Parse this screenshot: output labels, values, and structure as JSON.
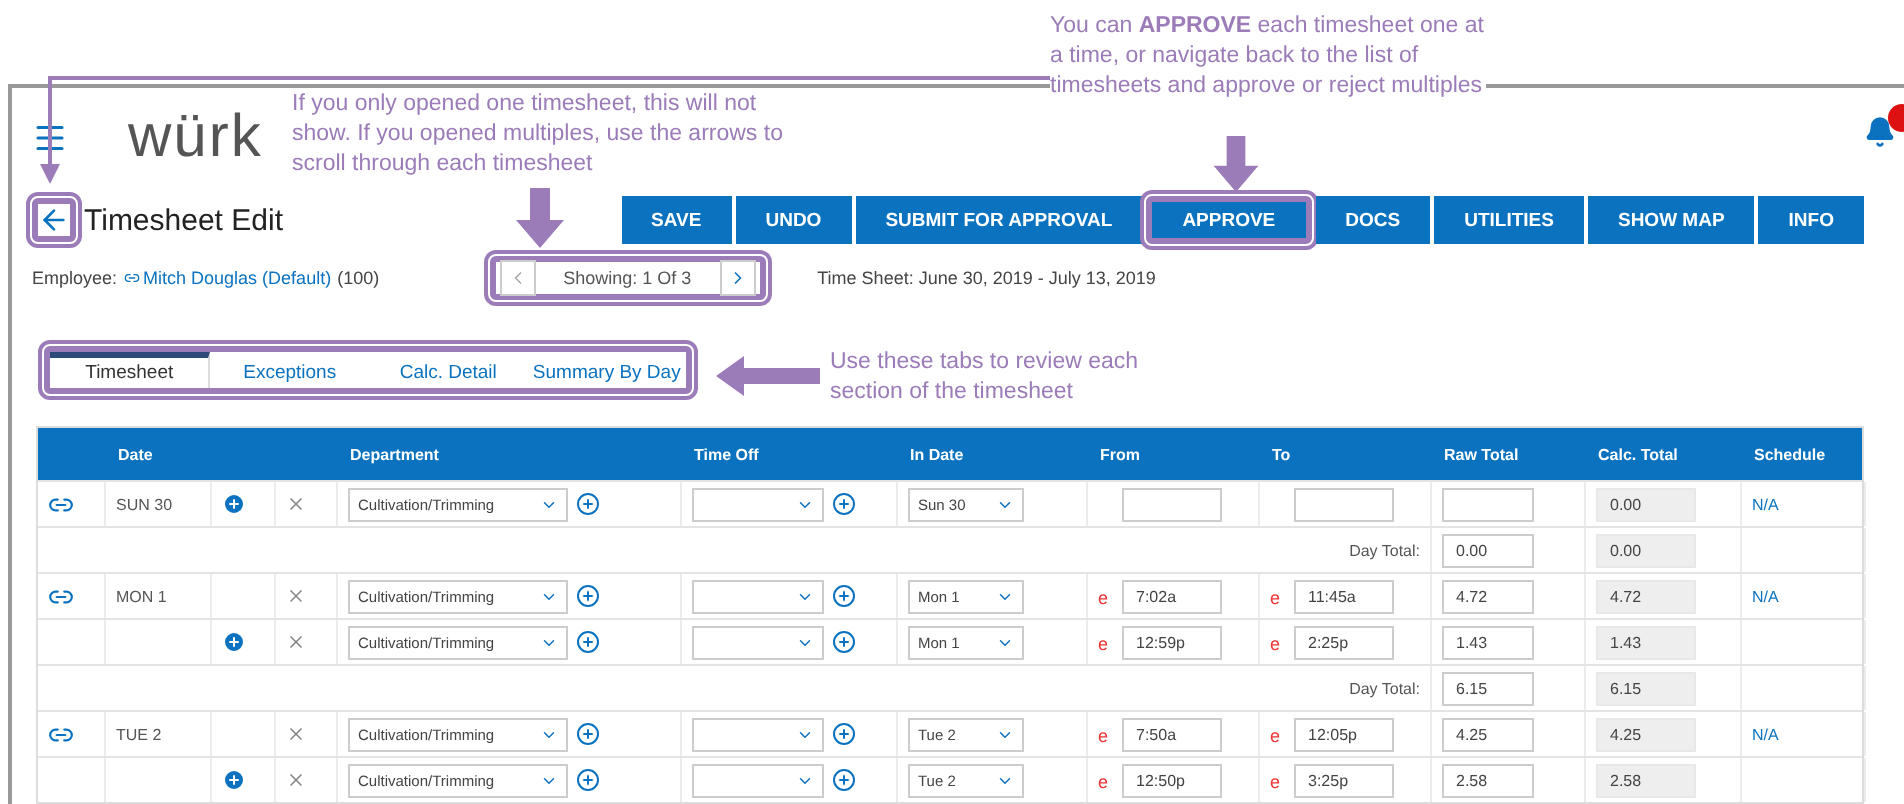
{
  "header": {
    "logo": "würk",
    "title": "Timesheet Edit",
    "back_highlighted": true
  },
  "toolbar": [
    {
      "label": "SAVE",
      "highlighted": false
    },
    {
      "label": "UNDO",
      "highlighted": false
    },
    {
      "label": "SUBMIT FOR APPROVAL",
      "highlighted": false
    },
    {
      "label": "APPROVE",
      "highlighted": true
    },
    {
      "label": "DOCS",
      "highlighted": false
    },
    {
      "label": "UTILITIES",
      "highlighted": false
    },
    {
      "label": "SHOW MAP",
      "highlighted": false
    },
    {
      "label": "INFO",
      "highlighted": false
    }
  ],
  "employee": {
    "label": "Employee:",
    "name": "Mitch Douglas (Default)",
    "number": "(100)"
  },
  "pager": {
    "text": "Showing: 1 Of 3",
    "highlighted": true
  },
  "period": "Time Sheet: June 30, 2019 - July 13, 2019",
  "tabs": {
    "highlighted": true,
    "items": [
      {
        "label": "Timesheet",
        "selected": true
      },
      {
        "label": "Exceptions",
        "selected": false
      },
      {
        "label": "Calc. Detail",
        "selected": false
      },
      {
        "label": "Summary By Day",
        "selected": false
      }
    ]
  },
  "table": {
    "columns": [
      "Date",
      "Department",
      "Time Off",
      "In Date",
      "From",
      "To",
      "Raw Total",
      "Calc. Total",
      "Schedule"
    ],
    "rows": [
      {
        "kind": "entry",
        "new_entry": true,
        "date": "SUN 30",
        "add": true,
        "department": "Cultivation/Trimming",
        "in_date": "Sun 30",
        "calc": "0.00",
        "schedule": "N/A"
      },
      {
        "kind": "total",
        "label": "Day Total:",
        "raw": "0.00",
        "calc": "0.00"
      },
      {
        "kind": "entry",
        "new_entry": true,
        "date": "MON 1",
        "add": false,
        "department": "Cultivation/Trimming",
        "in_date": "Mon 1",
        "from_mark": "e",
        "from": "7:02a",
        "to_mark": "e",
        "to": "11:45a",
        "raw": "4.72",
        "calc": "4.72",
        "schedule": "N/A"
      },
      {
        "kind": "entry",
        "new_entry": false,
        "add": true,
        "department": "Cultivation/Trimming",
        "in_date": "Mon 1",
        "from_mark": "e",
        "from": "12:59p",
        "to_mark": "e",
        "to": "2:25p",
        "raw": "1.43",
        "calc": "1.43"
      },
      {
        "kind": "total",
        "label": "Day Total:",
        "raw": "6.15",
        "calc": "6.15"
      },
      {
        "kind": "entry",
        "new_entry": true,
        "date": "TUE 2",
        "add": false,
        "department": "Cultivation/Trimming",
        "in_date": "Tue 2",
        "from_mark": "e",
        "from": "7:50a",
        "to_mark": "e",
        "to": "12:05p",
        "raw": "4.25",
        "calc": "4.25",
        "schedule": "N/A"
      },
      {
        "kind": "entry",
        "new_entry": false,
        "add": true,
        "department": "Cultivation/Trimming",
        "in_date": "Tue 2",
        "from_mark": "e",
        "from": "12:50p",
        "to_mark": "e",
        "to": "3:25p",
        "raw": "2.58",
        "calc": "2.58"
      }
    ]
  },
  "callouts": [
    "If you only opened one timesheet, this will not show. If you opened multiples, use the arrows to scroll through each timesheet",
    "You can **APPROVE** each timesheet one at a time, or navigate back to the list of timesheets and approve or reject multiples",
    "Use these tabs to review each section of the timesheet"
  ]
}
